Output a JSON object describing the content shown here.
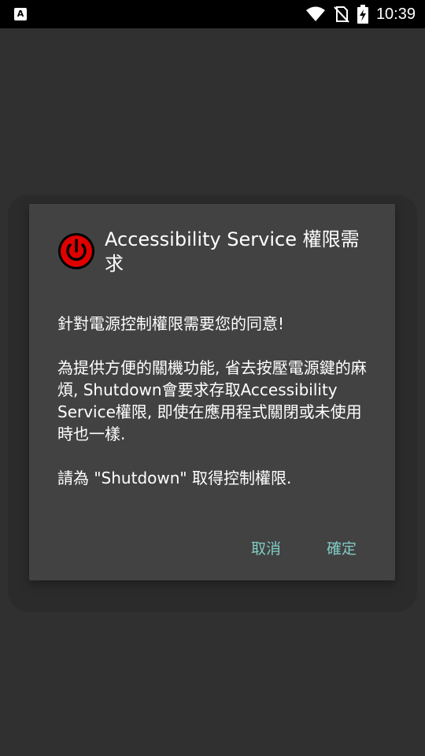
{
  "status_bar": {
    "time": "10:39",
    "notification_icon": "a-notification-icon",
    "icons": [
      "wifi-icon",
      "no-sim-icon",
      "battery-charging-icon"
    ]
  },
  "dialog": {
    "icon": "power-icon",
    "icon_color": "#e00000",
    "title": "Accessibility Service 權限需求",
    "message_line1": "針對電源控制權限需要您的同意!",
    "message_line2": "為提供方便的關機功能, 省去按壓電源鍵的麻煩, Shutdown會要求存取Accessibility Service權限, 即使在應用程式關閉或未使用時也一樣.",
    "message_line3": "請為 \"Shutdown\" 取得控制權限.",
    "cancel_label": "取消",
    "ok_label": "確定",
    "button_color": "#80cbc4"
  }
}
